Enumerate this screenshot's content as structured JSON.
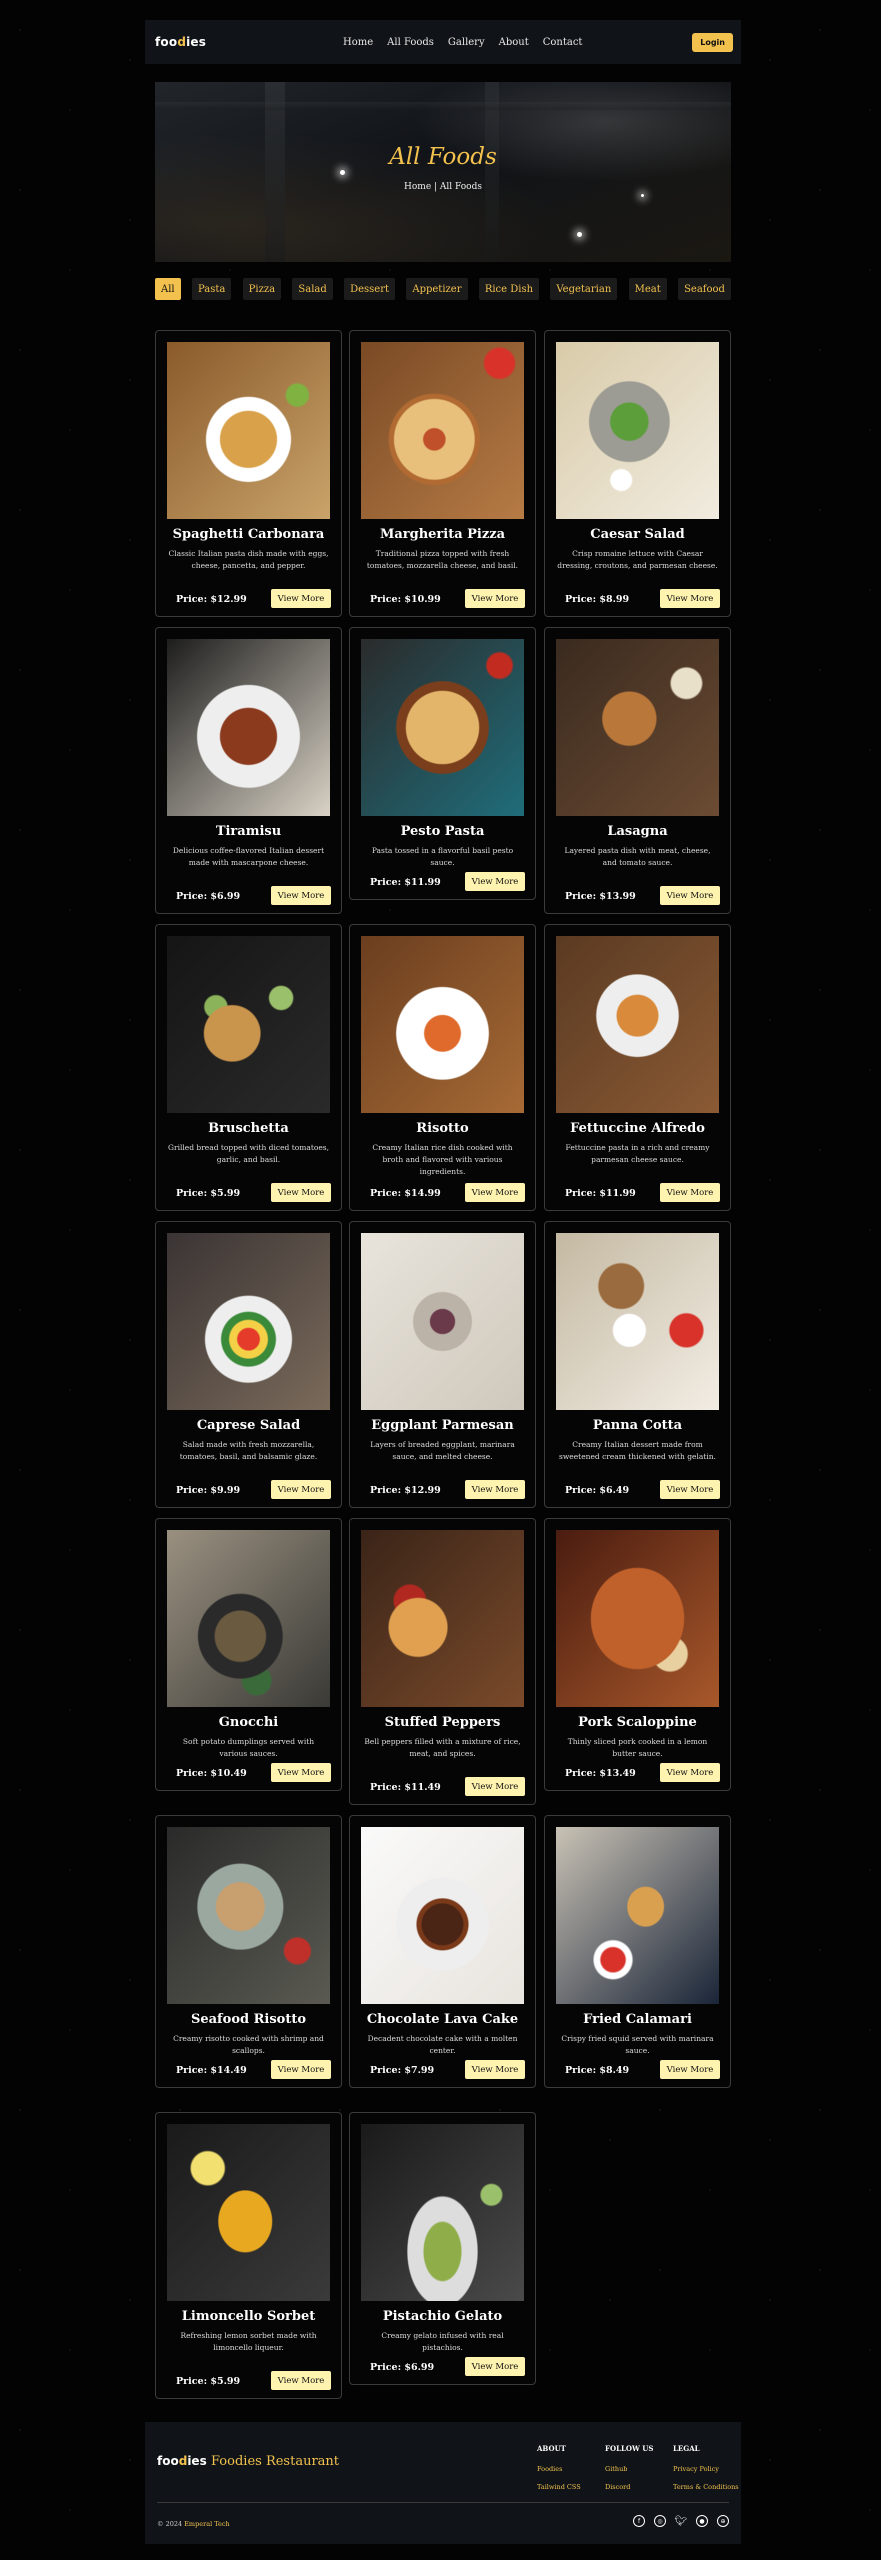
{
  "nav": {
    "logo_a": "foo",
    "logo_b": "d",
    "logo_c": "ies",
    "links": [
      "Home",
      "All Foods",
      "Gallery",
      "About",
      "Contact"
    ],
    "login": "Login"
  },
  "hero": {
    "title": "All Foods",
    "breadcrumb": "Home | All Foods"
  },
  "filters": [
    "All",
    "Pasta",
    "Pizza",
    "Salad",
    "Dessert",
    "Appetizer",
    "Rice Dish",
    "Vegetarian",
    "Meat",
    "Seafood"
  ],
  "view_label": "View More",
  "foods": [
    {
      "name": "Spaghetti Carbonara",
      "desc": "Classic Italian pasta dish made with eggs, cheese, pancetta, and pepper.",
      "price": "Price: $12.99"
    },
    {
      "name": "Margherita Pizza",
      "desc": "Traditional pizza topped with fresh tomatoes, mozzarella cheese, and basil.",
      "price": "Price: $10.99"
    },
    {
      "name": "Caesar Salad",
      "desc": "Crisp romaine lettuce with Caesar dressing, croutons, and parmesan cheese.",
      "price": "Price: $8.99"
    },
    {
      "name": "Tiramisu",
      "desc": "Delicious coffee-flavored Italian dessert made with mascarpone cheese.",
      "price": "Price: $6.99"
    },
    {
      "name": "Pesto Pasta",
      "desc": "Pasta tossed in a flavorful basil pesto sauce.",
      "price": "Price: $11.99"
    },
    {
      "name": "Lasagna",
      "desc": "Layered pasta dish with meat, cheese, and tomato sauce.",
      "price": "Price: $13.99"
    },
    {
      "name": "Bruschetta",
      "desc": "Grilled bread topped with diced tomatoes, garlic, and basil.",
      "price": "Price: $5.99"
    },
    {
      "name": "Risotto",
      "desc": "Creamy Italian rice dish cooked with broth and flavored with various ingredients.",
      "price": "Price: $14.99"
    },
    {
      "name": "Fettuccine Alfredo",
      "desc": "Fettuccine pasta in a rich and creamy parmesan cheese sauce.",
      "price": "Price: $11.99"
    },
    {
      "name": "Caprese Salad",
      "desc": "Salad made with fresh mozzarella, tomatoes, basil, and balsamic glaze.",
      "price": "Price: $9.99"
    },
    {
      "name": "Eggplant Parmesan",
      "desc": "Layers of breaded eggplant, marinara sauce, and melted cheese.",
      "price": "Price: $12.99"
    },
    {
      "name": "Panna Cotta",
      "desc": "Creamy Italian dessert made from sweetened cream thickened with gelatin.",
      "price": "Price: $6.49"
    },
    {
      "name": "Gnocchi",
      "desc": "Soft potato dumplings served with various sauces.",
      "price": "Price: $10.49"
    },
    {
      "name": "Stuffed Peppers",
      "desc": "Bell peppers filled with a mixture of rice, meat, and spices.",
      "price": "Price: $11.49"
    },
    {
      "name": "Pork Scaloppine",
      "desc": "Thinly sliced pork cooked in a lemon butter sauce.",
      "price": "Price: $13.49"
    },
    {
      "name": "Seafood Risotto",
      "desc": "Creamy risotto cooked with shrimp and scallops.",
      "price": "Price: $14.49"
    },
    {
      "name": "Chocolate Lava Cake",
      "desc": "Decadent chocolate cake with a molten center.",
      "price": "Price: $7.99"
    },
    {
      "name": "Fried Calamari",
      "desc": "Crispy fried squid served with marinara sauce.",
      "price": "Price: $8.49"
    },
    {
      "name": "Limoncello Sorbet",
      "desc": "Refreshing lemon sorbet made with limoncello liqueur.",
      "price": "Price: $5.99"
    },
    {
      "name": "Pistachio Gelato",
      "desc": "Creamy gelato infused with real pistachios.",
      "price": "Price: $6.99"
    }
  ],
  "footer": {
    "brand": "Foodies Restaurant",
    "cols": [
      {
        "head": "ABOUT",
        "links": [
          "Foodies",
          "Tailwind CSS"
        ]
      },
      {
        "head": "FOLLOW US",
        "links": [
          "Github",
          "Discord"
        ]
      },
      {
        "head": "LEGAL",
        "links": [
          "Privacy Policy",
          "Terms & Conditions"
        ]
      }
    ],
    "copy_a": "© 2024 ",
    "copy_b": "Emperal Tech",
    "socials": [
      "facebook-icon",
      "instagram-icon",
      "twitter-icon",
      "github-icon",
      "dribbble-icon"
    ]
  },
  "colors": {
    "accent": "#f2c14e",
    "button": "#fff3b0",
    "card_border": "#3b3b3b",
    "bg": "#030303"
  }
}
